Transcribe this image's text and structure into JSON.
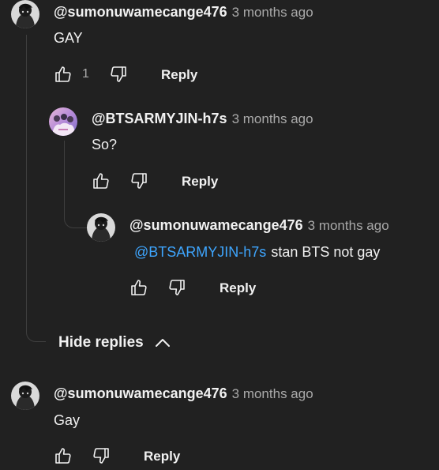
{
  "comments": [
    {
      "author": "@sumonuwamecange476",
      "time": "3 months ago",
      "text": "GAY",
      "likes": "1",
      "reply_label": "Reply"
    },
    {
      "author": "@BTSARMYJIN-h7s",
      "time": "3 months ago",
      "text": "So?",
      "likes": "",
      "reply_label": "Reply"
    },
    {
      "author": "@sumonuwamecange476",
      "time": "3 months ago",
      "mention": "@BTSARMYJIN-h7s",
      "text": "stan BTS not gay",
      "likes": "",
      "reply_label": "Reply"
    },
    {
      "author": "@sumonuwamecange476",
      "time": "3 months ago",
      "text": "Gay",
      "likes": "",
      "reply_label": "Reply"
    }
  ],
  "hide_replies_label": "Hide replies",
  "icons": {
    "like": "thumbs-up-icon",
    "dislike": "thumbs-down-icon",
    "collapse": "chevron-up-icon"
  },
  "colors": {
    "background": "#212121",
    "text": "#f1f1f1",
    "secondary_text": "#aaaaaa",
    "mention": "#3ea6ff"
  }
}
